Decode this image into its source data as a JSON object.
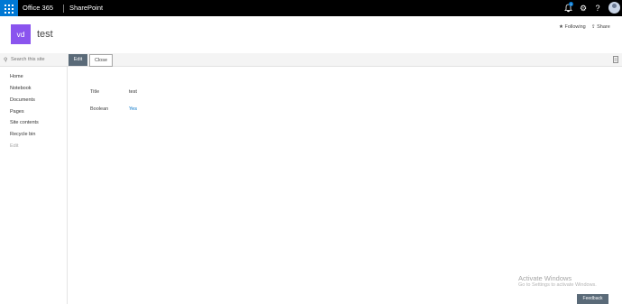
{
  "suite_bar": {
    "brand": "Office 365",
    "app": "SharePoint",
    "notification_count": "1",
    "icons": [
      "app-launcher-icon",
      "notification-bell-icon",
      "gear-icon",
      "help-icon"
    ]
  },
  "site": {
    "logo_initials": "vd",
    "title": "test",
    "following_label": "Following",
    "share_label": "Share"
  },
  "search": {
    "placeholder": "Search this site"
  },
  "toolbar": {
    "edit_label": "Edit",
    "close_label": "Close"
  },
  "nav": {
    "items": [
      {
        "label": "Home"
      },
      {
        "label": "Notebook"
      },
      {
        "label": "Documents"
      },
      {
        "label": "Pages"
      },
      {
        "label": "Site contents"
      },
      {
        "label": "Recycle bin"
      }
    ],
    "edit_label": "Edit"
  },
  "form": {
    "fields": [
      {
        "label": "Title",
        "value": "test"
      },
      {
        "label": "Boolean",
        "value": "Yes"
      }
    ]
  },
  "watermark": {
    "line1": "Activate Windows",
    "line2": "Go to Settings to activate Windows."
  },
  "feedback_label": "Feedback",
  "colors": {
    "suite_bar": "#000000",
    "waffle": "#0078d4",
    "site_logo": "#8a54ee",
    "primary_button": "#5a6a78",
    "link": "#0072c6"
  }
}
